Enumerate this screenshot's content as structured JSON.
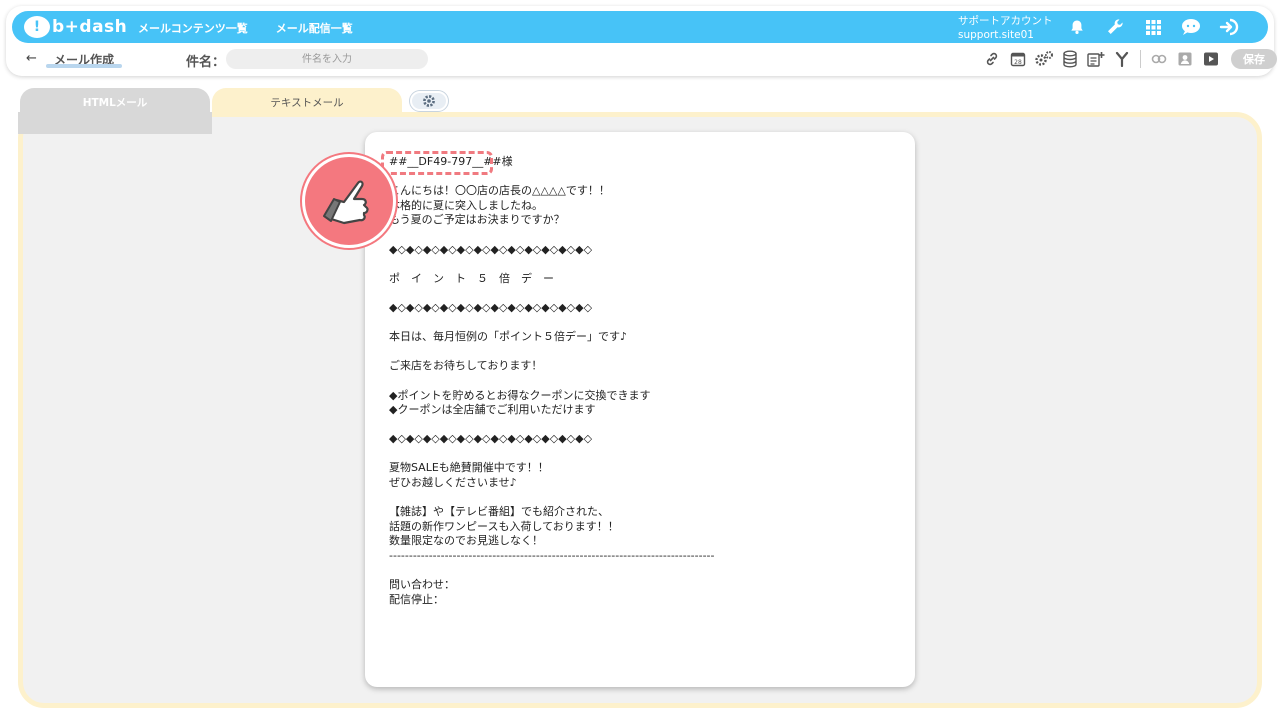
{
  "header": {
    "logo_badge": "!",
    "logo_text": "b+dash",
    "nav": [
      "メールコンテンツ一覧",
      "メール配信一覧"
    ],
    "account_name": "サポートアカウント",
    "account_id": "support.site01",
    "icons": [
      "bell-icon",
      "wrench-icon",
      "apps-grid-icon",
      "chat-icon",
      "logout-icon"
    ]
  },
  "subbar": {
    "back_arrow": "←",
    "page_title": "メール作成",
    "subject_label": "件名：",
    "subject_placeholder": "件名を入力",
    "subject_value": "",
    "save_label": "保存"
  },
  "tabs": {
    "html_label": "HTMLメール",
    "text_label": "テキストメール"
  },
  "editor": {
    "body": "##__DF49-797__##様\n\nこんにちは！〇〇店の店長の△△△△です！！\n本格的に夏に突入しましたね。\nもう夏のご予定はお決まりですか？\n\n◆◇◆◇◆◇◆◇◆◇◆◇◆◇◆◇◆◇◆◇◆◇◆◇\n\nポ　イ　ン　ト　５　倍　デ　ー\n\n◆◇◆◇◆◇◆◇◆◇◆◇◆◇◆◇◆◇◆◇◆◇◆◇\n\n本日は、毎月恒例の「ポイント５倍デー」です♪\n\nご来店をお待ちしております！\n\n◆ポイントを貯めるとお得なクーポンに交換できます\n◆クーポンは全店舗でご利用いただけます\n\n◆◇◆◇◆◇◆◇◆◇◆◇◆◇◆◇◆◇◆◇◆◇◆◇\n\n夏物SALEも絶賛開催中です！！\nぜひお越しくださいませ♪\n\n【雑誌】や【テレビ番組】でも紹介された、\n話題の新作ワンピースも入荷しております！！\n数量限定なのでお見逃しなく！\n----------------------------------------------------------------------------------\n\n問い合わせ：\n配信停止："
  },
  "colors": {
    "header_blue": "#47c3f7",
    "tab_active": "#fdf1cc",
    "highlight": "#f07a80"
  }
}
